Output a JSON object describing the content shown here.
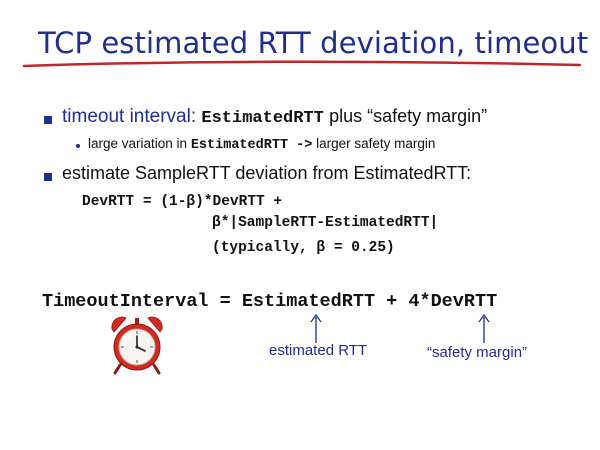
{
  "slide": {
    "title": "TCP estimated RTT deviation, timeout",
    "bullet1": {
      "prefix": "timeout interval:",
      "code": "EstimatedRTT",
      "suffix": "plus “safety margin”",
      "sub": {
        "prefix": "large variation in",
        "code": "EstimatedRTT ->",
        "suffix": "larger safety margin"
      }
    },
    "bullet2": {
      "text": "estimate SampleRTT deviation from EstimatedRTT:",
      "code_line1": "DevRTT = (1-β)*DevRTT +",
      "code_line2": "β*|SampleRTT-EstimatedRTT|",
      "code_line3": "(typically, β = 0.25)"
    },
    "formula": "TimeoutInterval = EstimatedRTT + 4*DevRTT",
    "annotation_estimated": "estimated RTT",
    "annotation_margin": "“safety margin”",
    "icon": "alarm-clock-icon",
    "colors": {
      "accent": "#1f2d8f",
      "underline": "#c0272d",
      "clock_red": "#d42a1e"
    }
  }
}
